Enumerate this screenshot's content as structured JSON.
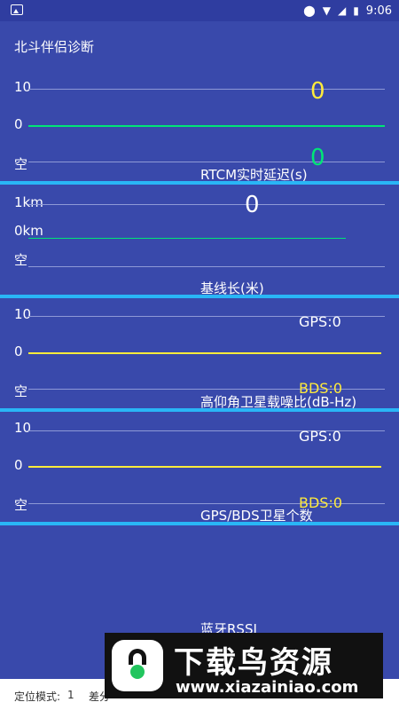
{
  "status_bar": {
    "time": "9:06",
    "icons": [
      "image-icon",
      "location-icon",
      "wifi-icon",
      "signal-icon",
      "battery-charging-icon"
    ]
  },
  "app": {
    "title": "北斗伴侣诊断"
  },
  "panels": {
    "rtcm": {
      "caption": "RTCM实时延迟(s)",
      "y_labels": [
        "10",
        "0",
        "空"
      ],
      "value_primary": "0",
      "value_secondary": "0",
      "colors": {
        "primary": "#ffeb3b",
        "secondary": "#00e676",
        "line": "#00e676"
      }
    },
    "baseline": {
      "caption": "基线长(米)",
      "y_labels": [
        "1km",
        "0km",
        "空"
      ],
      "value": "0",
      "colors": {
        "line": "#00e676",
        "value": "#ffffff"
      }
    },
    "elevation_snr": {
      "caption": "高仰角卫星载噪比(dB-Hz)",
      "y_labels": [
        "10",
        "0",
        "空"
      ],
      "gps_label": "GPS:0",
      "bds_label": "BDS:0",
      "colors": {
        "gps": "#ffffff",
        "bds": "#ffeb3b",
        "line": "#ffeb3b"
      }
    },
    "sat_count": {
      "caption": "GPS/BDS卫星个数",
      "y_labels": [
        "10",
        "0",
        "空"
      ],
      "gps_label": "GPS:0",
      "bds_label": "BDS:0",
      "colors": {
        "gps": "#ffffff",
        "bds": "#ffeb3b",
        "line": "#ffeb3b"
      }
    },
    "bluetooth": {
      "caption": "蓝牙RSSI"
    }
  },
  "footer": {
    "positioning_mode_label": "定位模式:",
    "positioning_mode_value": "1",
    "diff_label": "差分"
  },
  "watermark": {
    "title": "下载鸟资源",
    "url": "www.xiazainiao.com"
  },
  "colors": {
    "background": "#3949ab",
    "separator": "#29b6f6",
    "gridline": "#8e99d6"
  }
}
